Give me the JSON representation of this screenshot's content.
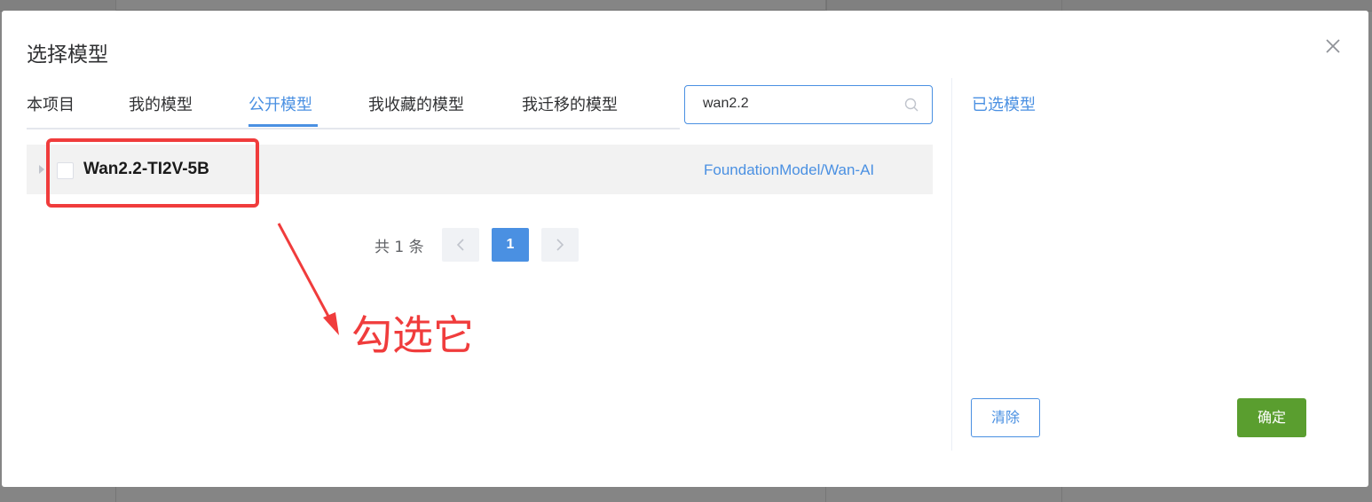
{
  "dialog": {
    "title": "选择模型"
  },
  "tabs": [
    {
      "label": "本项目",
      "active": false
    },
    {
      "label": "我的模型",
      "active": false
    },
    {
      "label": "公开模型",
      "active": true
    },
    {
      "label": "我收藏的模型",
      "active": false
    },
    {
      "label": "我迁移的模型",
      "active": false
    }
  ],
  "search": {
    "value": "wan2.2",
    "icon": "search-icon"
  },
  "models": [
    {
      "name": "Wan2.2-TI2V-5B",
      "source": "FoundationModel/Wan-AI",
      "checked": false
    }
  ],
  "pagination": {
    "total_label": "共 1 条",
    "current_page": "1"
  },
  "selected_panel": {
    "title": "已选模型",
    "clear_label": "清除",
    "confirm_label": "确定"
  },
  "annotation": {
    "text": "勾选它",
    "color": "#f03c3c"
  },
  "colors": {
    "accent": "#4a90e2",
    "confirm": "#5a9e2f",
    "annotation": "#f03c3c"
  }
}
